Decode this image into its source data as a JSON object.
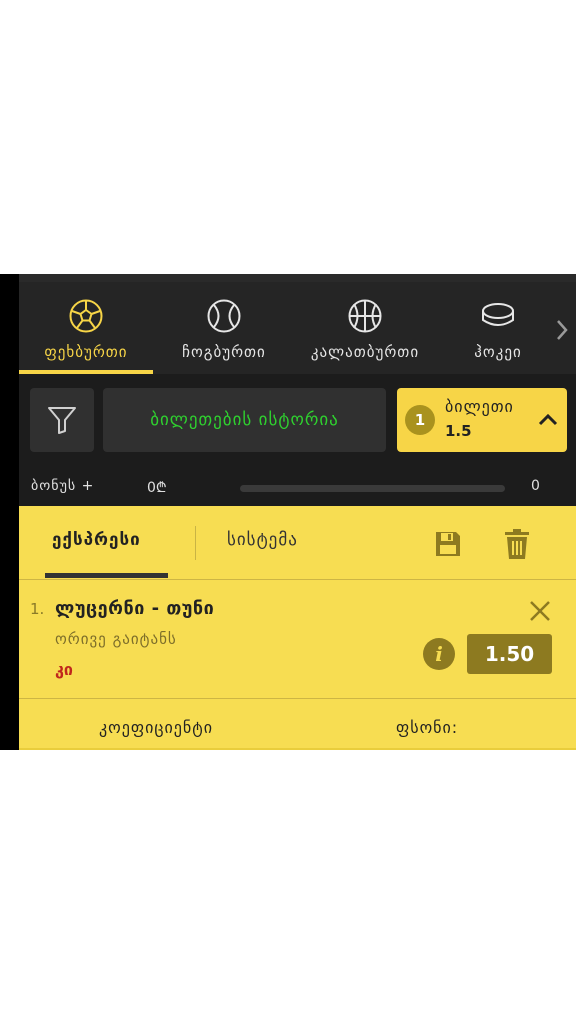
{
  "sports": {
    "items": [
      {
        "label": "ფეხბურთი",
        "icon": "soccer-ball-icon",
        "active": true
      },
      {
        "label": "ჩოგბურთი",
        "icon": "tennis-ball-icon",
        "active": false
      },
      {
        "label": "კალათბურთი",
        "icon": "basketball-icon",
        "active": false
      },
      {
        "label": "ჰოკეი",
        "icon": "hockey-puck-icon",
        "active": false
      }
    ],
    "more_icon": "chevron-right-icon"
  },
  "toolbar": {
    "filter_icon": "filter-funnel-icon",
    "history_label": "ბილეთების ისტორია",
    "ticket_count": "1",
    "ticket_label": "ბილეთი",
    "ticket_odds": "1.5"
  },
  "bonus": {
    "label": "ბონუს +",
    "amount": "0₾",
    "progress": 0,
    "count": "0"
  },
  "betslip": {
    "tabs": [
      "ექსპრესი",
      "სისტემა"
    ],
    "active_tab": "ექსპრესი",
    "save_icon": "floppy-disk-icon",
    "trash_icon": "trash-icon",
    "bet": {
      "index": "1.",
      "match": "ლუცერნი - თუნი",
      "market": "ორივე გაიტანს",
      "outcome": "კი",
      "odds": "1.50",
      "info_icon": "i"
    },
    "coefficient_label": "კოეფიციენტი",
    "price_label": "ფსონი:"
  },
  "colors": {
    "accent": "#f7d547",
    "panel": "#f7dd52",
    "history_text": "#2fd12f",
    "outcome_text": "#c0271c",
    "odds_bg": "#8d7a20"
  }
}
